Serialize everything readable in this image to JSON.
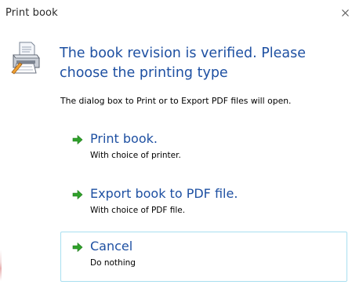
{
  "window": {
    "title": "Print book",
    "close_glyph": "✕"
  },
  "header": {
    "icon": "printer-icon",
    "main_instruction": "The book revision is verified. Please choose the printing type",
    "content": "The dialog box to Print or to Export PDF files will open."
  },
  "commands": [
    {
      "title": "Print book.",
      "subtitle": "With choice of printer.",
      "icon": "green-arrow-icon"
    },
    {
      "title": "Export book to PDF file.",
      "subtitle": "With choice of PDF file.",
      "icon": "green-arrow-icon"
    },
    {
      "title": "Cancel",
      "subtitle": "Do nothing",
      "icon": "green-arrow-icon",
      "focused": true
    }
  ],
  "colors": {
    "instruction_blue": "#1e50a2",
    "arrow_green": "#2fa12a",
    "focus_border": "#a8dff0"
  }
}
